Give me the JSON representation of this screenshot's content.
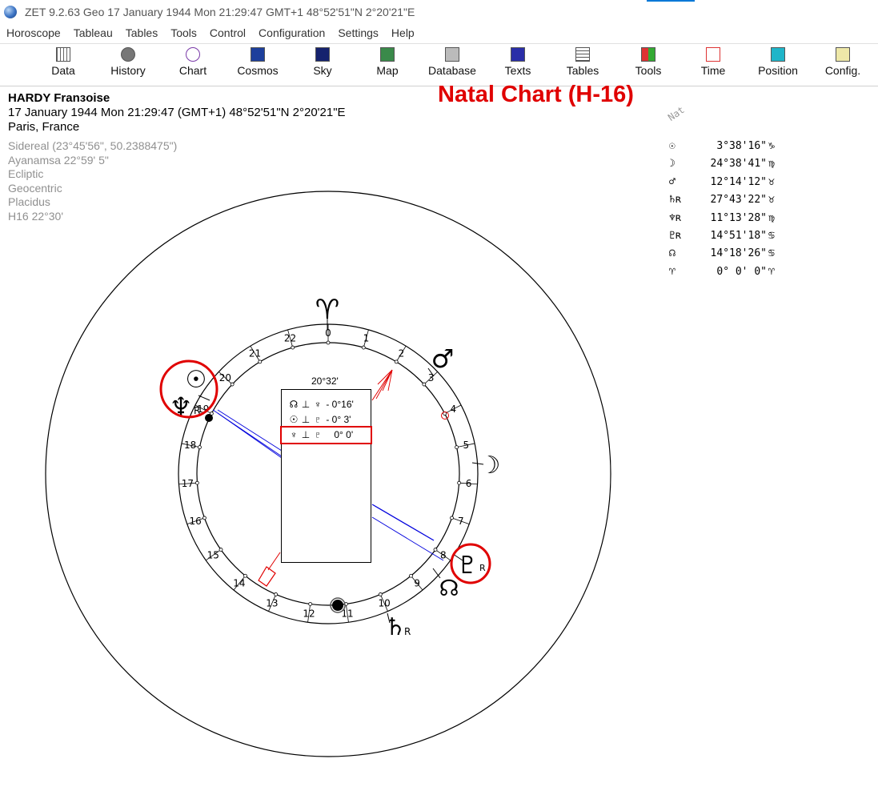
{
  "window": {
    "title": "ZET 9.2.63 Geo    17 January 1944  Mon  21:29:47 GMT+1 48°52'51\"N  2°20'21\"E"
  },
  "menu": [
    "Horoscope",
    "Tableau",
    "Tables",
    "Tools",
    "Control",
    "Configuration",
    "Settings",
    "Help"
  ],
  "toolbar": [
    {
      "label": "Data",
      "icon": "data-grid-icon"
    },
    {
      "label": "History",
      "icon": "history-disk-icon"
    },
    {
      "label": "Chart",
      "icon": "chart-wheel-icon"
    },
    {
      "label": "Cosmos",
      "icon": "cosmos-icon"
    },
    {
      "label": "Sky",
      "icon": "sky-stars-icon"
    },
    {
      "label": "Map",
      "icon": "map-icon"
    },
    {
      "label": "Database",
      "icon": "database-icon"
    },
    {
      "label": "Texts",
      "icon": "texts-book-icon"
    },
    {
      "label": "Tables",
      "icon": "tables-icon"
    },
    {
      "label": "Tools",
      "icon": "tools-icon"
    },
    {
      "label": "Time",
      "icon": "time-icon"
    },
    {
      "label": "Position",
      "icon": "position-icon"
    },
    {
      "label": "Config.",
      "icon": "config-icon"
    }
  ],
  "person": {
    "name": "HARDY Franзoise",
    "datetime": "17 January 1944  Mon  21:29:47 (GMT+1) 48°52'51\"N  2°20'21\"E",
    "place": "Paris, France"
  },
  "settings": [
    "Sidereal (23°45'56\", 50.2388475\")",
    "Ayanamsa 22°59' 5\"",
    "Ecliptic",
    "Geocentric",
    "Placidus",
    "H16  22°30'"
  ],
  "chart_title": "Natal Chart (H-16)",
  "nat_label": "Nat",
  "positions": [
    {
      "glyph": "☉",
      "value": "3°38'16\"",
      "sign": "♑"
    },
    {
      "glyph": "☽",
      "value": "24°38'41\"",
      "sign": "♍"
    },
    {
      "glyph": "♂",
      "value": "12°14'12\"",
      "sign": "♉"
    },
    {
      "glyph": "♄ʀ",
      "value": "27°43'22\"",
      "sign": "♉"
    },
    {
      "glyph": "♆ʀ",
      "value": "11°13'28\"",
      "sign": "♍"
    },
    {
      "glyph": "♇ʀ",
      "value": "14°51'18\"",
      "sign": "♋"
    },
    {
      "glyph": "☊",
      "value": "14°18'26\"",
      "sign": "♋"
    },
    {
      "glyph": "♈",
      "value": "0° 0' 0\"",
      "sign": "♈"
    }
  ],
  "aspects": {
    "header": "20°32'",
    "rows": [
      {
        "a": "☊",
        "sep": "⊥",
        "b": "♆",
        "orb": "- 0°16'"
      },
      {
        "a": "☉",
        "sep": "⊥",
        "b": "♇",
        "orb": "- 0° 3'"
      },
      {
        "a": "♆",
        "sep": "⊥",
        "b": "♇",
        "orb": "0° 0'"
      }
    ]
  },
  "wheel": {
    "aries_glyph": "♈",
    "house_numbers": [
      "0",
      "1",
      "2",
      "3",
      "4",
      "5",
      "6",
      "7",
      "8",
      "9",
      "10",
      "11",
      "12",
      "13",
      "14",
      "15",
      "16",
      "17",
      "18",
      "19",
      "20",
      "21",
      "22"
    ],
    "planet_glyphs": {
      "sun": "☉",
      "neptune": "♆",
      "mars": "♂",
      "moon": "☽",
      "pluto": "♇",
      "node": "☊",
      "saturn": "♄"
    },
    "retro_marker": "R",
    "colors": {
      "highlight": "#e00000",
      "aspect_blue": "#0000dd",
      "ring": "#000000"
    }
  }
}
